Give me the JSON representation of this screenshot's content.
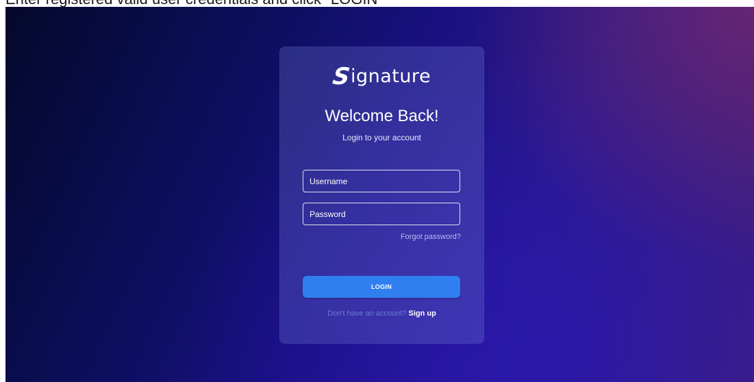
{
  "caption": "Enter registered valid user credentials and click \"LOGIN\"",
  "logo": {
    "mark": "S",
    "text": "ignature"
  },
  "login": {
    "title": "Welcome Back!",
    "subtitle": "Login to your account",
    "username_placeholder": "Username",
    "password_placeholder": "Password",
    "forgot_label": "Forgot password?",
    "login_label": "LOGIN",
    "signup_prompt": "Don't have an account?",
    "signup_label": "Sign up"
  },
  "colors": {
    "button": "#2f7ff0",
    "card": "rgba(120,130,220,0.28)",
    "muted_text": "#6f78d6"
  },
  "icons": [
    "signature-logo-icon"
  ]
}
